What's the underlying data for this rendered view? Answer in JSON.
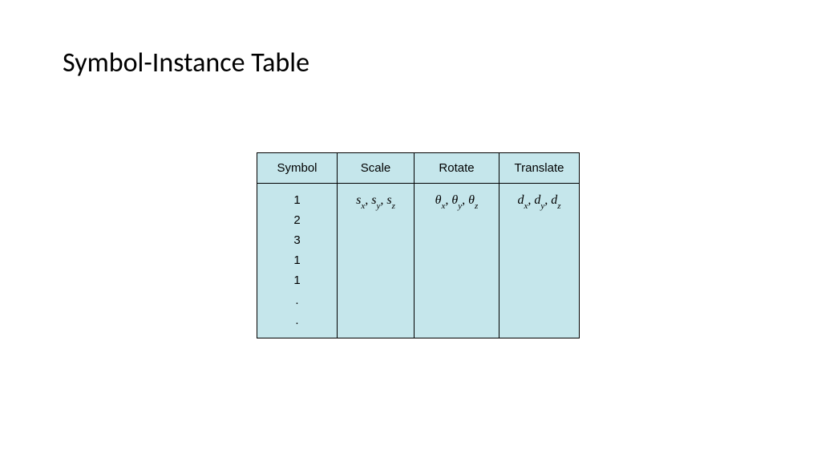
{
  "title": "Symbol-Instance Table",
  "headers": {
    "symbol": "Symbol",
    "scale": "Scale",
    "rotate": "Rotate",
    "translate": "Translate"
  },
  "symbolColumn": [
    "1",
    "2",
    "3",
    "1",
    "1",
    ".",
    "."
  ],
  "scaleCell": {
    "var": "s",
    "subs": [
      "x",
      "y",
      "z"
    ]
  },
  "rotateCell": {
    "var": "θ",
    "subs": [
      "x",
      "y",
      "z"
    ]
  },
  "translateCell": {
    "var": "d",
    "subs": [
      "x",
      "y",
      "z"
    ]
  }
}
